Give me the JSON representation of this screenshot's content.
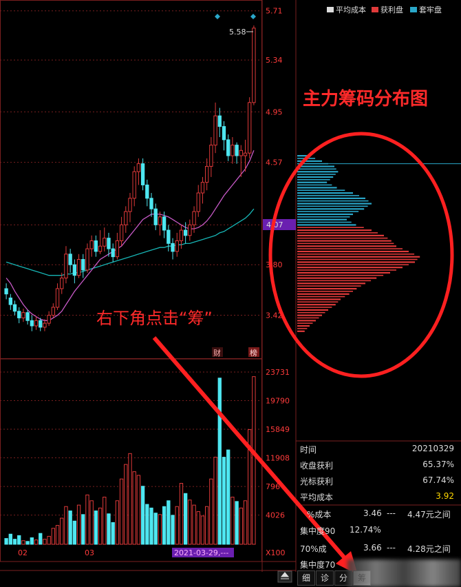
{
  "price_axis": [
    "5.71",
    "5.34",
    "4.95",
    "4.57",
    "4.1",
    "3.80",
    "3.42"
  ],
  "current_price": "4.07",
  "high_label": "5.58",
  "volume_axis": [
    "23731",
    "19790",
    "15849",
    "11908",
    "796",
    "4026",
    "X100"
  ],
  "month_labels": [
    "02",
    "03"
  ],
  "date_highlight": "2021-03-29,---",
  "markers": {
    "cai": "财",
    "bang": "榜"
  },
  "legend": [
    {
      "label": "平均成本",
      "color": "#dddddd"
    },
    {
      "label": "获利盘",
      "color": "#e03a3a"
    },
    {
      "label": "套牢盘",
      "color": "#2aa7c9"
    }
  ],
  "annotations": {
    "title": "主力筹码分布图",
    "hint": "右下角点击“筹”"
  },
  "stats": [
    {
      "k": "时间",
      "v": "20210329"
    },
    {
      "k": "收盘获利",
      "v": "65.37%"
    },
    {
      "k": "光标获利",
      "v": "67.74%"
    },
    {
      "k": "平均成本",
      "v": "3.92"
    }
  ],
  "concentration": [
    {
      "label": "%成本",
      "low": "3.46",
      "dash": "---",
      "high": "4.47元之间"
    },
    {
      "label": "集中度90",
      "value": "12.74%"
    },
    {
      "label": "70%成",
      "low": "3.66",
      "dash": "---",
      "high": "4.28元之间"
    },
    {
      "label": "集中度70"
    }
  ],
  "tabs": [
    "细",
    "诊",
    "分",
    "筹"
  ],
  "colors": {
    "up": "#e03a3a",
    "down": "#4ee6f0",
    "ma_short": "#c85ac8",
    "ma_long": "#17b5b5",
    "grid": "#7a1f1f"
  },
  "chart_data": {
    "type": "candlestick",
    "ylim": [
      3.2,
      5.75
    ],
    "candles": [
      [
        3.62,
        3.58,
        3.66,
        3.54
      ],
      [
        3.55,
        3.5,
        3.58,
        3.46
      ],
      [
        3.5,
        3.45,
        3.53,
        3.42
      ],
      [
        3.45,
        3.4,
        3.48,
        3.36
      ],
      [
        3.4,
        3.44,
        3.47,
        3.37
      ],
      [
        3.44,
        3.38,
        3.46,
        3.35
      ],
      [
        3.38,
        3.34,
        3.42,
        3.3
      ],
      [
        3.34,
        3.38,
        3.41,
        3.31
      ],
      [
        3.38,
        3.33,
        3.4,
        3.3
      ],
      [
        3.33,
        3.36,
        3.39,
        3.3
      ],
      [
        3.36,
        3.42,
        3.45,
        3.34
      ],
      [
        3.42,
        3.48,
        3.51,
        3.4
      ],
      [
        3.48,
        3.62,
        3.66,
        3.46
      ],
      [
        3.62,
        3.7,
        3.74,
        3.58
      ],
      [
        3.7,
        3.88,
        3.94,
        3.66
      ],
      [
        3.88,
        3.8,
        3.92,
        3.74
      ],
      [
        3.8,
        3.72,
        3.84,
        3.66
      ],
      [
        3.72,
        3.84,
        3.88,
        3.7
      ],
      [
        3.84,
        3.76,
        3.88,
        3.7
      ],
      [
        3.76,
        3.92,
        3.96,
        3.74
      ],
      [
        3.92,
        3.98,
        4.02,
        3.86
      ],
      [
        3.98,
        3.9,
        4.02,
        3.86
      ],
      [
        3.9,
        3.94,
        4.06,
        3.88
      ],
      [
        3.94,
        4.0,
        4.08,
        3.9
      ],
      [
        4.0,
        3.92,
        4.04,
        3.86
      ],
      [
        3.92,
        3.86,
        3.96,
        3.82
      ],
      [
        3.86,
        3.98,
        4.04,
        3.84
      ],
      [
        3.98,
        4.1,
        4.16,
        3.94
      ],
      [
        4.1,
        4.2,
        4.24,
        4.04
      ],
      [
        4.2,
        4.3,
        4.34,
        4.12
      ],
      [
        4.3,
        4.5,
        4.54,
        4.24
      ],
      [
        4.5,
        4.56,
        4.6,
        4.4
      ],
      [
        4.56,
        4.4,
        4.6,
        4.36
      ],
      [
        4.4,
        4.3,
        4.44,
        4.24
      ],
      [
        4.3,
        4.22,
        4.34,
        4.16
      ],
      [
        4.22,
        4.1,
        4.26,
        4.06
      ],
      [
        4.1,
        4.16,
        4.2,
        4.02
      ],
      [
        4.16,
        4.06,
        4.2,
        4.0
      ],
      [
        4.06,
        3.96,
        4.1,
        3.9
      ],
      [
        3.96,
        3.9,
        4.0,
        3.84
      ],
      [
        3.9,
        3.98,
        4.04,
        3.86
      ],
      [
        3.98,
        4.06,
        4.1,
        3.92
      ],
      [
        4.06,
        4.02,
        4.12,
        3.96
      ],
      [
        4.02,
        4.1,
        4.14,
        3.98
      ],
      [
        4.1,
        4.2,
        4.24,
        4.04
      ],
      [
        4.2,
        4.34,
        4.4,
        4.16
      ],
      [
        4.34,
        4.42,
        4.46,
        4.26
      ],
      [
        4.42,
        4.54,
        4.6,
        4.36
      ],
      [
        4.54,
        4.7,
        4.76,
        4.46
      ],
      [
        4.7,
        4.92,
        5.02,
        4.64
      ],
      [
        4.92,
        4.84,
        4.98,
        4.76
      ],
      [
        4.84,
        4.74,
        4.88,
        4.66
      ],
      [
        4.74,
        4.62,
        4.78,
        4.58
      ],
      [
        4.62,
        4.7,
        4.76,
        4.56
      ],
      [
        4.7,
        4.62,
        4.72,
        4.56
      ],
      [
        4.62,
        4.66,
        4.7,
        4.46
      ],
      [
        4.62,
        4.64,
        4.74,
        4.5
      ],
      [
        4.64,
        5.02,
        5.06,
        4.6
      ],
      [
        5.02,
        5.58,
        5.6,
        5.0
      ]
    ],
    "volumes": [
      800,
      1400,
      700,
      1200,
      500,
      400,
      900,
      600,
      1500,
      700,
      1100,
      2200,
      2600,
      3600,
      5200,
      4600,
      3200,
      5400,
      4100,
      6800,
      6000,
      4600,
      5000,
      6500,
      4200,
      3000,
      6000,
      9000,
      11000,
      12500,
      10000,
      9500,
      8000,
      5500,
      5000,
      4300,
      4100,
      5200,
      6000,
      4000,
      5200,
      8400,
      7000,
      6100,
      5400,
      4500,
      3900,
      5200,
      9000,
      12000,
      22900,
      12000,
      13000,
      6500,
      5900,
      5000,
      6000,
      15800,
      23100
    ],
    "ma_short": [
      3.7,
      3.66,
      3.6,
      3.55,
      3.5,
      3.46,
      3.43,
      3.41,
      3.39,
      3.38,
      3.38,
      3.4,
      3.42,
      3.45,
      3.5,
      3.55,
      3.6,
      3.64,
      3.68,
      3.72,
      3.76,
      3.8,
      3.84,
      3.86,
      3.88,
      3.9,
      3.92,
      3.94,
      3.98,
      4.02,
      4.06,
      4.1,
      4.14,
      4.16,
      4.18,
      4.18,
      4.18,
      4.17,
      4.16,
      4.14,
      4.12,
      4.1,
      4.08,
      4.07,
      4.07,
      4.08,
      4.1,
      4.13,
      4.17,
      4.22,
      4.27,
      4.32,
      4.36,
      4.4,
      4.44,
      4.48,
      4.52,
      4.58,
      4.66
    ],
    "ma_long": [
      3.82,
      3.81,
      3.8,
      3.79,
      3.78,
      3.77,
      3.76,
      3.75,
      3.74,
      3.73,
      3.72,
      3.72,
      3.72,
      3.72,
      3.73,
      3.73,
      3.74,
      3.74,
      3.75,
      3.76,
      3.77,
      3.78,
      3.79,
      3.8,
      3.81,
      3.82,
      3.83,
      3.84,
      3.85,
      3.86,
      3.87,
      3.88,
      3.89,
      3.9,
      3.91,
      3.92,
      3.93,
      3.93,
      3.94,
      3.94,
      3.95,
      3.95,
      3.96,
      3.96,
      3.97,
      3.98,
      3.99,
      4.0,
      4.01,
      4.02,
      4.04,
      4.05,
      4.07,
      4.09,
      4.11,
      4.13,
      4.15,
      4.18,
      4.22
    ],
    "chips": [
      {
        "price": 4.62,
        "w": 18,
        "type": "trapped"
      },
      {
        "price": 4.58,
        "w": 40,
        "type": "trapped"
      },
      {
        "price": 4.54,
        "w": 60,
        "type": "trapped"
      },
      {
        "price": 4.5,
        "w": 66,
        "type": "trapped"
      },
      {
        "price": 4.46,
        "w": 58,
        "type": "trapped"
      },
      {
        "price": 4.42,
        "w": 48,
        "type": "trapped"
      },
      {
        "price": 4.38,
        "w": 64,
        "type": "trapped"
      },
      {
        "price": 4.34,
        "w": 90,
        "type": "trapped"
      },
      {
        "price": 4.3,
        "w": 110,
        "type": "trapped"
      },
      {
        "price": 4.26,
        "w": 120,
        "type": "trapped"
      },
      {
        "price": 4.22,
        "w": 108,
        "type": "trapped"
      },
      {
        "price": 4.18,
        "w": 90,
        "type": "trapped"
      },
      {
        "price": 4.14,
        "w": 80,
        "type": "trapped"
      },
      {
        "price": 4.1,
        "w": 95,
        "type": "trapped"
      },
      {
        "price": 4.06,
        "w": 120,
        "type": "profit"
      },
      {
        "price": 4.02,
        "w": 140,
        "type": "profit"
      },
      {
        "price": 3.98,
        "w": 152,
        "type": "profit"
      },
      {
        "price": 3.94,
        "w": 160,
        "type": "profit"
      },
      {
        "price": 3.9,
        "w": 180,
        "type": "profit"
      },
      {
        "price": 3.86,
        "w": 198,
        "type": "profit"
      },
      {
        "price": 3.82,
        "w": 190,
        "type": "profit"
      },
      {
        "price": 3.78,
        "w": 170,
        "type": "profit"
      },
      {
        "price": 3.74,
        "w": 150,
        "type": "profit"
      },
      {
        "price": 3.7,
        "w": 128,
        "type": "profit"
      },
      {
        "price": 3.66,
        "w": 110,
        "type": "profit"
      },
      {
        "price": 3.62,
        "w": 96,
        "type": "profit"
      },
      {
        "price": 3.58,
        "w": 84,
        "type": "profit"
      },
      {
        "price": 3.54,
        "w": 70,
        "type": "profit"
      },
      {
        "price": 3.5,
        "w": 62,
        "type": "profit"
      },
      {
        "price": 3.46,
        "w": 50,
        "type": "profit"
      },
      {
        "price": 3.42,
        "w": 40,
        "type": "profit"
      },
      {
        "price": 3.38,
        "w": 30,
        "type": "profit"
      },
      {
        "price": 3.34,
        "w": 20,
        "type": "profit"
      },
      {
        "price": 3.3,
        "w": 12,
        "type": "profit"
      }
    ]
  }
}
